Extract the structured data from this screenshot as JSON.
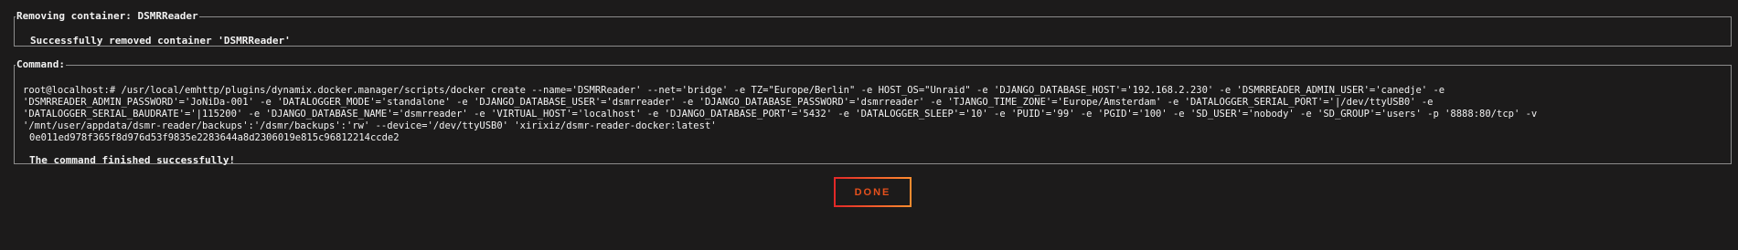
{
  "removing": {
    "legend": "Removing container: DSMRReader",
    "message": "Successfully removed container 'DSMRReader'"
  },
  "command": {
    "legend": "Command:",
    "lines": [
      "root@localhost:# /usr/local/emhttp/plugins/dynamix.docker.manager/scripts/docker create --name='DSMRReader' --net='bridge' -e TZ=\"Europe/Berlin\" -e HOST_OS=\"Unraid\" -e 'DJANGO_DATABASE_HOST'='192.168.2.230' -e 'DSMRREADER_ADMIN_USER'='canedje' -e",
      "'DSMRREADER_ADMIN_PASSWORD'='JoNiDa-001' -e 'DATALOGGER_MODE'='standalone' -e 'DJANGO_DATABASE_USER'='dsmrreader' -e 'DJANGO_DATABASE_PASSWORD'='dsmrreader' -e 'TJANGO_TIME_ZONE'='Europe/Amsterdam' -e 'DATALOGGER_SERIAL_PORT'='|/dev/ttyUSB0' -e",
      "'DATALOGGER_SERIAL_BAUDRATE'='|115200' -e 'DJANGO_DATABASE_NAME'='dsmrreader' -e 'VIRTUAL_HOST'='localhost' -e 'DJANGO_DATABASE_PORT'='5432' -e 'DATALOGGER_SLEEP'='10' -e 'PUID'='99' -e 'PGID'='100' -e 'SD_USER'='nobody' -e 'SD_GROUP'='users' -p '8888:80/tcp' -v",
      "'/mnt/user/appdata/dsmr-reader/backups':'/dsmr/backups':'rw' --device='/dev/ttyUSB0' 'xirixiz/dsmr-reader-docker:latest'"
    ],
    "container_id": "0e011ed978f365f8d976d53f9835e2283644a8d2306019e815c96812214ccde2",
    "finished": "The command finished successfully!"
  },
  "done_button": {
    "label": "Done"
  },
  "colors": {
    "background": "#1c1b1b",
    "border": "#8c8c8c",
    "accent_start": "#e22828",
    "accent_end": "#ff8c2f"
  }
}
